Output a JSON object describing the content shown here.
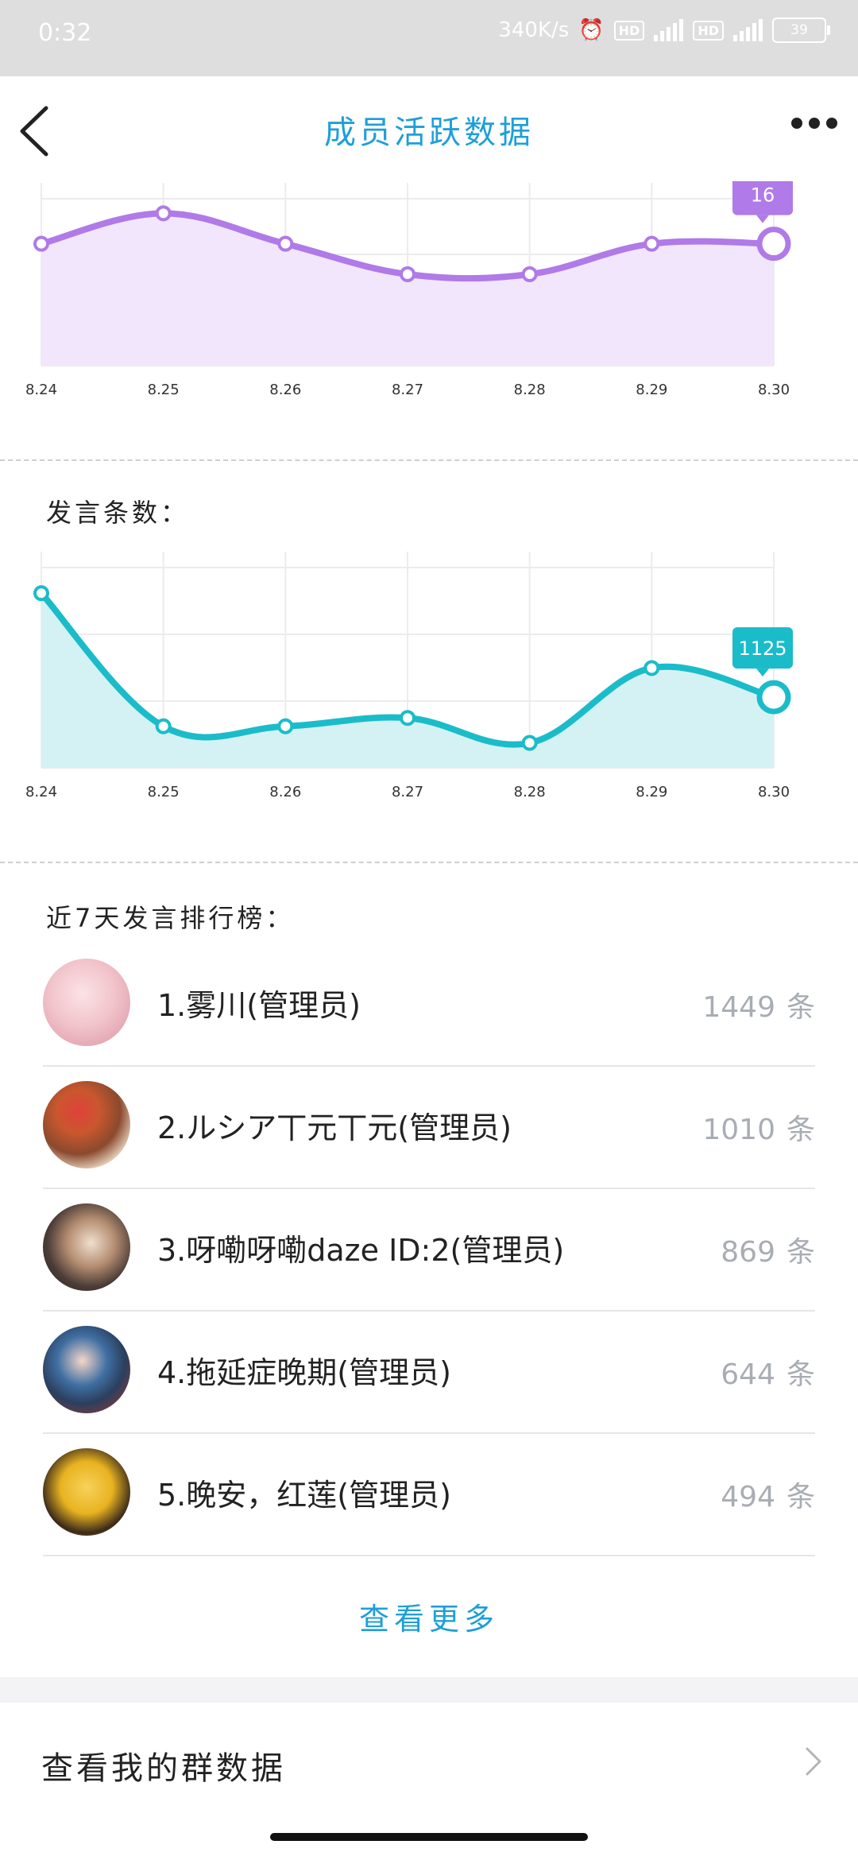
{
  "status_bar": {
    "time": "0:32",
    "speed": "340K/s",
    "net1": "4G",
    "net2": "4G",
    "hd": "HD",
    "battery": "39"
  },
  "header": {
    "title": "成员活跃数据",
    "back_icon": "back-chevron-icon",
    "more_icon": "more-dots-icon"
  },
  "chart_data": [
    {
      "type": "area",
      "title": "",
      "categories": [
        "8.24",
        "8.25",
        "8.26",
        "8.27",
        "8.28",
        "8.29",
        "8.30"
      ],
      "values": [
        15,
        16,
        15,
        14,
        14,
        15,
        15
      ],
      "ylim": [
        11,
        17
      ],
      "color": "#b07ae8",
      "fill": "#f1e6fb",
      "highlight_label": "16",
      "highlight_index": 6
    },
    {
      "type": "area",
      "title": "发言条数：",
      "categories": [
        "8.24",
        "8.25",
        "8.26",
        "8.27",
        "8.28",
        "8.29",
        "8.30"
      ],
      "values": [
        1750,
        950,
        950,
        1000,
        850,
        1300,
        1125
      ],
      "ylim": [
        700,
        2000
      ],
      "color": "#1bbcc9",
      "fill": "#d4f2f4",
      "highlight_label": "1125",
      "highlight_index": 6
    }
  ],
  "ranking": {
    "title": "近7天发言排行榜：",
    "unit": "条",
    "items": [
      {
        "name": "1.雾川(管理员)",
        "count": "1449"
      },
      {
        "name": "2.ルシア丅元丅元(管理员)",
        "count": "1010"
      },
      {
        "name": "3.呀嘞呀嘞daze ID:2(管理员)",
        "count": "869"
      },
      {
        "name": "4.拖延症晚期(管理员)",
        "count": "644"
      },
      {
        "name": "5.晚安，红莲(管理员)",
        "count": "494"
      }
    ],
    "view_more": "查看更多"
  },
  "my_group": {
    "label": "查看我的群数据"
  }
}
